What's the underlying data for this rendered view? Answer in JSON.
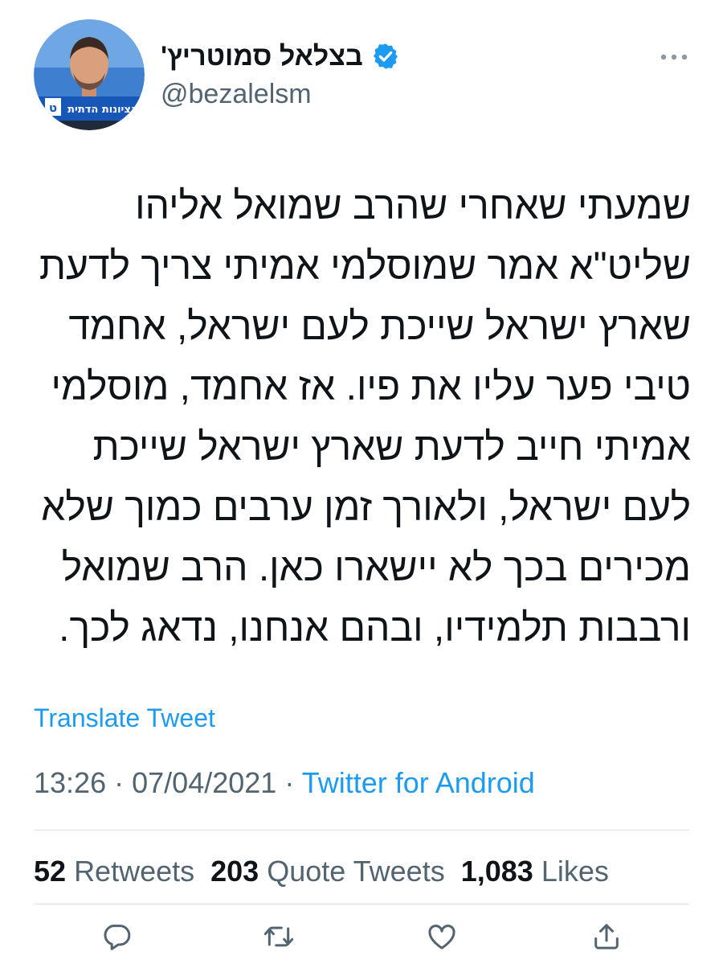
{
  "author": {
    "display_name": "בצלאל סמוטריץ'",
    "handle": "@bezalelsm",
    "verified": true,
    "avatar_banner_text": "הציונות הדתית",
    "avatar_banner_letter": "ט"
  },
  "tweet": {
    "lines": [
      "שמעתי שאחרי שהרב שמואל אליהו",
      "שליט\"א אמר שמוסלמי אמיתי צריך לדעת",
      "שארץ ישראל שייכת לעם ישראל, אחמד",
      "טיבי פער עליו את פיו. אז אחמד, מוסלמי",
      "אמיתי חייב לדעת שארץ ישראל שייכת",
      "לעם ישראל, ולאורך זמן ערבים כמוך שלא",
      "מכירים בכך לא יישארו כאן. הרב שמואל",
      "ורבבות תלמידיו, ובהם אנחנו, נדאג לכך."
    ],
    "translate_label": "Translate Tweet",
    "time": "13:26",
    "date": "07/04/2021",
    "separator": "·",
    "source": "Twitter for Android"
  },
  "stats": {
    "retweets_count": "52",
    "retweets_label": "Retweets",
    "quotes_count": "203",
    "quotes_label": "Quote Tweets",
    "likes_count": "1,083",
    "likes_label": "Likes"
  },
  "icons": {
    "verified": "verified-badge-icon",
    "more": "more-dots-icon",
    "reply": "reply-icon",
    "retweet": "retweet-icon",
    "like": "heart-icon",
    "share": "share-icon"
  },
  "colors": {
    "accent": "#1d9bf0",
    "text": "#0f1419",
    "secondary": "#536471",
    "divider": "#dcdfe2"
  }
}
